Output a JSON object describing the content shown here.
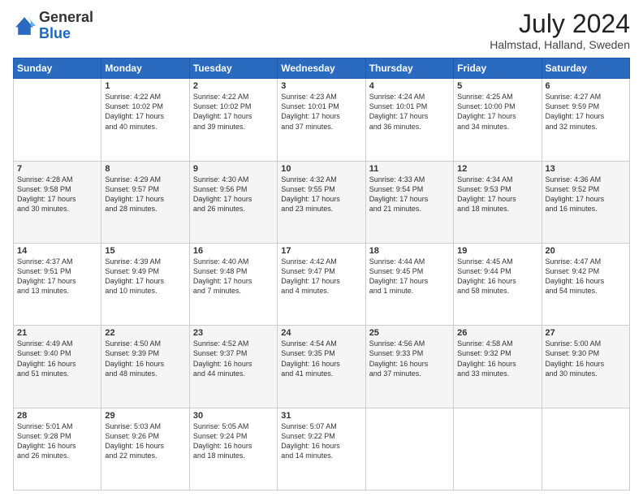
{
  "logo": {
    "general": "General",
    "blue": "Blue"
  },
  "header": {
    "month_year": "July 2024",
    "location": "Halmstad, Halland, Sweden"
  },
  "days": {
    "headers": [
      "Sunday",
      "Monday",
      "Tuesday",
      "Wednesday",
      "Thursday",
      "Friday",
      "Saturday"
    ]
  },
  "weeks": [
    {
      "cells": [
        {
          "day": "",
          "content": ""
        },
        {
          "day": "1",
          "content": "Sunrise: 4:22 AM\nSunset: 10:02 PM\nDaylight: 17 hours\nand 40 minutes."
        },
        {
          "day": "2",
          "content": "Sunrise: 4:22 AM\nSunset: 10:02 PM\nDaylight: 17 hours\nand 39 minutes."
        },
        {
          "day": "3",
          "content": "Sunrise: 4:23 AM\nSunset: 10:01 PM\nDaylight: 17 hours\nand 37 minutes."
        },
        {
          "day": "4",
          "content": "Sunrise: 4:24 AM\nSunset: 10:01 PM\nDaylight: 17 hours\nand 36 minutes."
        },
        {
          "day": "5",
          "content": "Sunrise: 4:25 AM\nSunset: 10:00 PM\nDaylight: 17 hours\nand 34 minutes."
        },
        {
          "day": "6",
          "content": "Sunrise: 4:27 AM\nSunset: 9:59 PM\nDaylight: 17 hours\nand 32 minutes."
        }
      ]
    },
    {
      "cells": [
        {
          "day": "7",
          "content": "Sunrise: 4:28 AM\nSunset: 9:58 PM\nDaylight: 17 hours\nand 30 minutes."
        },
        {
          "day": "8",
          "content": "Sunrise: 4:29 AM\nSunset: 9:57 PM\nDaylight: 17 hours\nand 28 minutes."
        },
        {
          "day": "9",
          "content": "Sunrise: 4:30 AM\nSunset: 9:56 PM\nDaylight: 17 hours\nand 26 minutes."
        },
        {
          "day": "10",
          "content": "Sunrise: 4:32 AM\nSunset: 9:55 PM\nDaylight: 17 hours\nand 23 minutes."
        },
        {
          "day": "11",
          "content": "Sunrise: 4:33 AM\nSunset: 9:54 PM\nDaylight: 17 hours\nand 21 minutes."
        },
        {
          "day": "12",
          "content": "Sunrise: 4:34 AM\nSunset: 9:53 PM\nDaylight: 17 hours\nand 18 minutes."
        },
        {
          "day": "13",
          "content": "Sunrise: 4:36 AM\nSunset: 9:52 PM\nDaylight: 17 hours\nand 16 minutes."
        }
      ]
    },
    {
      "cells": [
        {
          "day": "14",
          "content": "Sunrise: 4:37 AM\nSunset: 9:51 PM\nDaylight: 17 hours\nand 13 minutes."
        },
        {
          "day": "15",
          "content": "Sunrise: 4:39 AM\nSunset: 9:49 PM\nDaylight: 17 hours\nand 10 minutes."
        },
        {
          "day": "16",
          "content": "Sunrise: 4:40 AM\nSunset: 9:48 PM\nDaylight: 17 hours\nand 7 minutes."
        },
        {
          "day": "17",
          "content": "Sunrise: 4:42 AM\nSunset: 9:47 PM\nDaylight: 17 hours\nand 4 minutes."
        },
        {
          "day": "18",
          "content": "Sunrise: 4:44 AM\nSunset: 9:45 PM\nDaylight: 17 hours\nand 1 minute."
        },
        {
          "day": "19",
          "content": "Sunrise: 4:45 AM\nSunset: 9:44 PM\nDaylight: 16 hours\nand 58 minutes."
        },
        {
          "day": "20",
          "content": "Sunrise: 4:47 AM\nSunset: 9:42 PM\nDaylight: 16 hours\nand 54 minutes."
        }
      ]
    },
    {
      "cells": [
        {
          "day": "21",
          "content": "Sunrise: 4:49 AM\nSunset: 9:40 PM\nDaylight: 16 hours\nand 51 minutes."
        },
        {
          "day": "22",
          "content": "Sunrise: 4:50 AM\nSunset: 9:39 PM\nDaylight: 16 hours\nand 48 minutes."
        },
        {
          "day": "23",
          "content": "Sunrise: 4:52 AM\nSunset: 9:37 PM\nDaylight: 16 hours\nand 44 minutes."
        },
        {
          "day": "24",
          "content": "Sunrise: 4:54 AM\nSunset: 9:35 PM\nDaylight: 16 hours\nand 41 minutes."
        },
        {
          "day": "25",
          "content": "Sunrise: 4:56 AM\nSunset: 9:33 PM\nDaylight: 16 hours\nand 37 minutes."
        },
        {
          "day": "26",
          "content": "Sunrise: 4:58 AM\nSunset: 9:32 PM\nDaylight: 16 hours\nand 33 minutes."
        },
        {
          "day": "27",
          "content": "Sunrise: 5:00 AM\nSunset: 9:30 PM\nDaylight: 16 hours\nand 30 minutes."
        }
      ]
    },
    {
      "cells": [
        {
          "day": "28",
          "content": "Sunrise: 5:01 AM\nSunset: 9:28 PM\nDaylight: 16 hours\nand 26 minutes."
        },
        {
          "day": "29",
          "content": "Sunrise: 5:03 AM\nSunset: 9:26 PM\nDaylight: 16 hours\nand 22 minutes."
        },
        {
          "day": "30",
          "content": "Sunrise: 5:05 AM\nSunset: 9:24 PM\nDaylight: 16 hours\nand 18 minutes."
        },
        {
          "day": "31",
          "content": "Sunrise: 5:07 AM\nSunset: 9:22 PM\nDaylight: 16 hours\nand 14 minutes."
        },
        {
          "day": "",
          "content": ""
        },
        {
          "day": "",
          "content": ""
        },
        {
          "day": "",
          "content": ""
        }
      ]
    }
  ]
}
